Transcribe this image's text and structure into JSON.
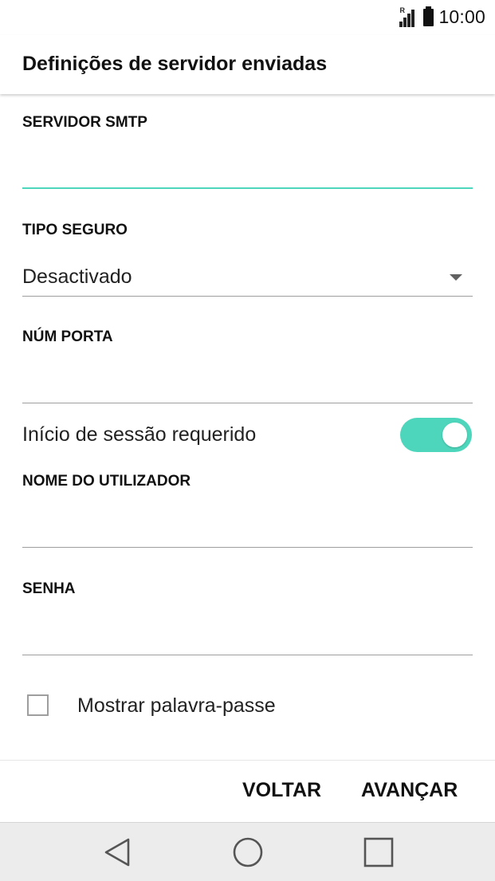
{
  "status_bar": {
    "time": "10:00",
    "roaming_indicator": "R",
    "signal_icon": "signal-icon",
    "battery_icon": "battery-icon"
  },
  "header": {
    "title": "Definições de servidor enviadas"
  },
  "form": {
    "smtp_server": {
      "label": "SERVIDOR SMTP",
      "value": ""
    },
    "security_type": {
      "label": "TIPO SEGURO",
      "value": "Desactivado"
    },
    "port_number": {
      "label": "NÚM PORTA",
      "value": ""
    },
    "login_required": {
      "label": "Início de sessão requerido",
      "enabled": true
    },
    "username": {
      "label": "NOME DO UTILIZADOR",
      "value": ""
    },
    "password": {
      "label": "SENHA",
      "value": ""
    },
    "show_password": {
      "label": "Mostrar palavra-passe",
      "checked": false
    }
  },
  "actions": {
    "back": "VOLTAR",
    "next": "AVANÇAR"
  },
  "navigation": {
    "back_icon": "triangle-back-icon",
    "home_icon": "circle-home-icon",
    "recent_icon": "square-recent-icon"
  },
  "colors": {
    "accent": "#4dd6bb",
    "divider": "#9e9e9e",
    "nav_background": "#ececec"
  }
}
